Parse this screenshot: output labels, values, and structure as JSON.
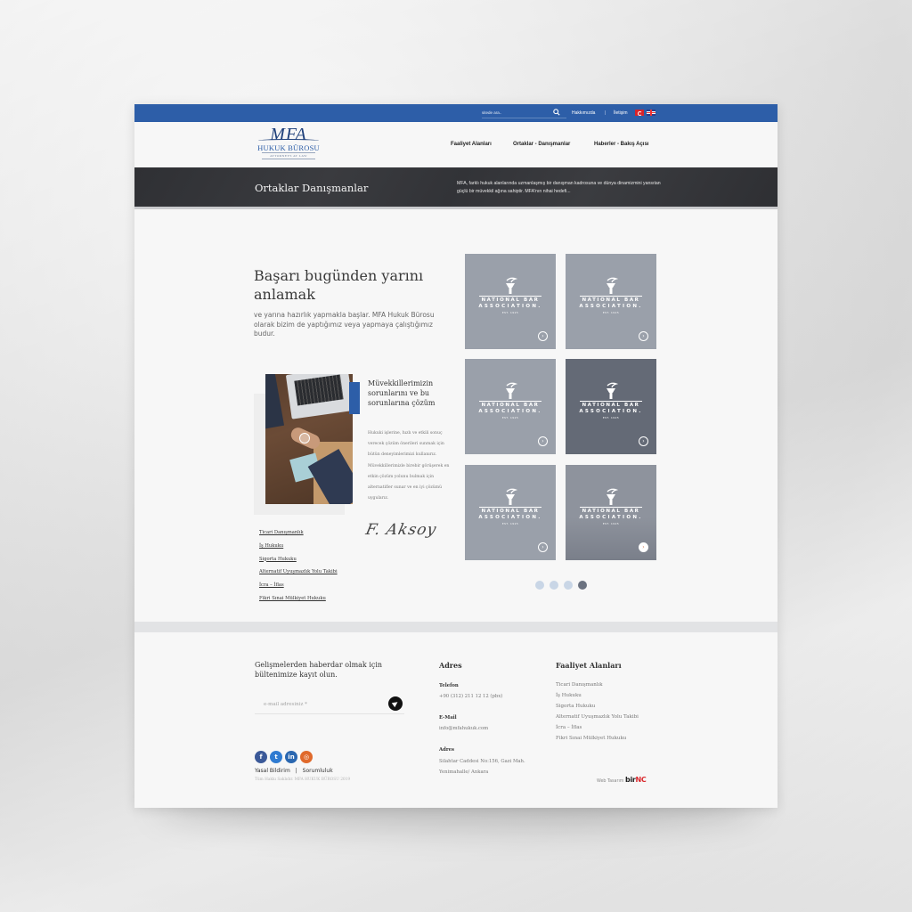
{
  "topbar": {
    "search_placeholder": "sitede ara..",
    "links": [
      "Hakkımızda",
      "İletişim"
    ],
    "separator": "|",
    "languages": [
      "Türkçe",
      "English"
    ],
    "color": "#2d5ea8"
  },
  "logo": {
    "mark": "MFA",
    "name": "HUKUK BÜROSU",
    "tagline": "ATTORNEYS AT LAW"
  },
  "nav": {
    "items": [
      "Faaliyet Alanları",
      "Ortaklar - Danışmanlar",
      "Haberler - Bakış Açısı"
    ]
  },
  "banner": {
    "title": "Ortaklar Danışmanlar",
    "description": "MFA, farklı hukuk alanlarında uzmanlaşmış bir danışman kadrosuna  ve dünya dinamizmini yansıtan güçlü bir müvekkil ağına sahiptir. MFA'nın nihai hedefi..."
  },
  "intro": {
    "headline": "Başarı bugünden yarını anlamak",
    "lead": "ve yarına hazırlık yapmakla başlar. MFA Hukuk Bürosu olarak bizim de yaptığımız veya yapmaya çalıştığımız budur."
  },
  "card": {
    "title": "Müvekkillerimizin sorunlarını ve bu sorunlarına çözüm",
    "text": "Hukuki işlerine, hızlı ve etkili sonuç verecek çözüm önerileri sunmak için bütün deneyimlerimizi kullanırız. Müvekkillerimizle birebir görüşerek en etkin çözüm yolunu bulmak için alternatifler sunar ve en iyi çözümü uygularız.",
    "signature": "F. Aksoy",
    "accent_color": "#2d5ea8"
  },
  "practice_areas": [
    "Ticari Danışmanlık",
    "İş Hukuku",
    "Sigorta Hukuku",
    "Alternatif Uyuşmazlık Yolu Takibi",
    "İcra – İflas",
    "Fikri Sınai Mülkiyet Hukuku"
  ],
  "tiles": [
    {
      "line1": "NATIONAL BAR",
      "line2": "ASSOCIATION.",
      "est": "EST. 1925",
      "color": "#9aa0aa"
    },
    {
      "line1": "NATIONAL BAR",
      "line2": "ASSOCIATION.",
      "est": "EST. 1925",
      "color": "#9aa0aa"
    },
    {
      "line1": "NATIONAL BAR",
      "line2": "ASSOCIATION.",
      "est": "EST. 1925",
      "color": "#9aa0aa"
    },
    {
      "line1": "NATIONAL BAR",
      "line2": "ASSOCIATION.",
      "est": "EST. 1925",
      "color": "#646a76"
    },
    {
      "line1": "NATIONAL BAR",
      "line2": "ASSOCIATION.",
      "est": "EST. 1925",
      "color": "#9aa0aa"
    },
    {
      "line1": "NATIONAL BAR",
      "line2": "ASSOCIATION.",
      "est": "EST. 1925",
      "color": "#8e939d"
    }
  ],
  "carousel": {
    "pages": 4,
    "active_page": 4,
    "inactive_color": "#c9d6e6",
    "active_color": "#6b7280"
  },
  "footer": {
    "newsletter_title": "Gelişmelerden haberdar olmak için bültenimize kayıt olun.",
    "email_placeholder": "e-mail adresiniz *",
    "social": [
      {
        "name": "facebook",
        "glyph": "f",
        "color": "#3b5998"
      },
      {
        "name": "twitter",
        "glyph": "t",
        "color": "#2f7bd1"
      },
      {
        "name": "linkedin",
        "glyph": "in",
        "color": "#2a67b0"
      },
      {
        "name": "instagram",
        "glyph": "◎",
        "color": "#e06a2c"
      }
    ],
    "legal_links": [
      "Yasal Bildirim",
      "|",
      "Sorumluluk"
    ],
    "copyright": "Tüm Hakkı Saklıdır. MFA HUKUK BÜROSU 2019",
    "address_col": {
      "title": "Adres",
      "phone_label": "Telefon",
      "phone": "+90 (312) 211 12 12 (pbx)",
      "email_label": "E-Mail",
      "email": "info@mfahukuk.com",
      "address_label": "Adres",
      "address_line1": "Silahtar Caddesi No:156, Gazi Mah.",
      "address_line2": "Yenimahalle/ Ankara"
    },
    "practice_col": {
      "title": "Faaliyet Alanları",
      "items": [
        "Ticari Danışmanlık",
        "İş Hukuku",
        "Sigorta Hukuku",
        "Alternatif Uyuşmazlık Yolu Takibi",
        "İcra – İflas",
        "Fikri Sınai Mülkiyet Hukuku"
      ]
    },
    "credit_label": "Web Tasarım",
    "credit_brand_a": "bir",
    "credit_brand_b": "NC"
  }
}
